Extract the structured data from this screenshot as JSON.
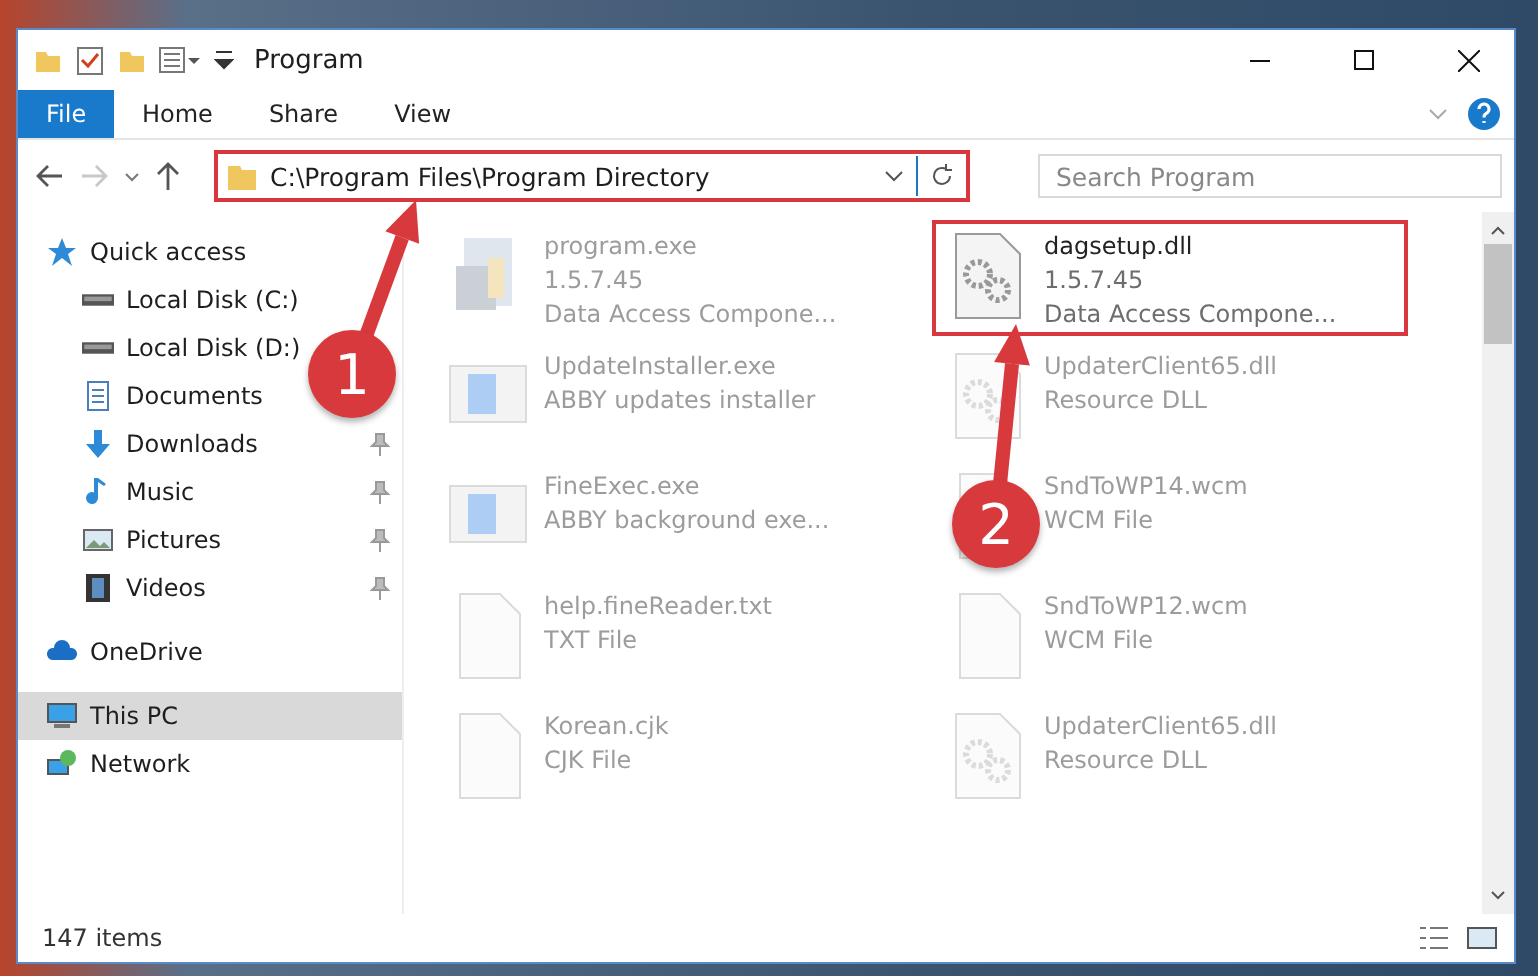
{
  "window": {
    "title": "Program"
  },
  "ribbon_tabs": [
    {
      "label": "File",
      "kind": "file"
    },
    {
      "label": "Home",
      "kind": "tab"
    },
    {
      "label": "Share",
      "kind": "tab"
    },
    {
      "label": "View",
      "kind": "tab"
    }
  ],
  "address_bar": {
    "path": "C:\\Program Files\\Program Directory",
    "highlighted": true
  },
  "search": {
    "placeholder": "Search Program"
  },
  "sidebar": {
    "items": [
      {
        "label": "Quick access",
        "kind": "star",
        "selected": false,
        "children": [
          {
            "label": "Local Disk (C:)",
            "kind": "drive",
            "pinned": false
          },
          {
            "label": "Local Disk (D:)",
            "kind": "drive",
            "pinned": false
          },
          {
            "label": "Documents",
            "kind": "document",
            "pinned": false
          },
          {
            "label": "Downloads",
            "kind": "download",
            "pinned": true
          },
          {
            "label": "Music",
            "kind": "music",
            "pinned": true
          },
          {
            "label": "Pictures",
            "kind": "pictures",
            "pinned": true
          },
          {
            "label": "Videos",
            "kind": "video",
            "pinned": true
          }
        ]
      },
      {
        "label": "OneDrive",
        "kind": "cloud",
        "selected": false
      },
      {
        "label": "This PC",
        "kind": "computer",
        "selected": true
      },
      {
        "label": "Network",
        "kind": "network",
        "selected": false
      }
    ]
  },
  "files": [
    {
      "lines": [
        "program.exe",
        "1.5.7.45",
        "Data Access Compone..."
      ],
      "kind": "installer",
      "dimmed": true,
      "highlighted": false
    },
    {
      "lines": [
        "dagsetup.dll",
        "1.5.7.45",
        "Data Access Compone..."
      ],
      "kind": "dll",
      "dimmed": false,
      "highlighted": true
    },
    {
      "lines": [
        "UpdateInstaller.exe",
        "ABBY updates installer"
      ],
      "kind": "app",
      "dimmed": true,
      "highlighted": false
    },
    {
      "lines": [
        "UpdaterClient65.dll",
        "Resource DLL"
      ],
      "kind": "dll",
      "dimmed": true,
      "highlighted": false
    },
    {
      "lines": [
        "FineExec.exe",
        "ABBY background exe..."
      ],
      "kind": "app",
      "dimmed": true,
      "highlighted": false
    },
    {
      "lines": [
        "SndToWP14.wcm",
        "WCM File"
      ],
      "kind": "blank",
      "dimmed": true,
      "highlighted": false
    },
    {
      "lines": [
        "help.fineReader.txt",
        "TXT File"
      ],
      "kind": "blank",
      "dimmed": true,
      "highlighted": false
    },
    {
      "lines": [
        "SndToWP12.wcm",
        "WCM File"
      ],
      "kind": "blank",
      "dimmed": true,
      "highlighted": false
    },
    {
      "lines": [
        "Korean.cjk",
        "CJK File"
      ],
      "kind": "blank",
      "dimmed": true,
      "highlighted": false
    },
    {
      "lines": [
        "UpdaterClient65.dll",
        "Resource DLL"
      ],
      "kind": "dll",
      "dimmed": true,
      "highlighted": false
    }
  ],
  "status_bar": {
    "count": "147 items"
  },
  "callouts": [
    {
      "number": "1"
    },
    {
      "number": "2"
    }
  ]
}
